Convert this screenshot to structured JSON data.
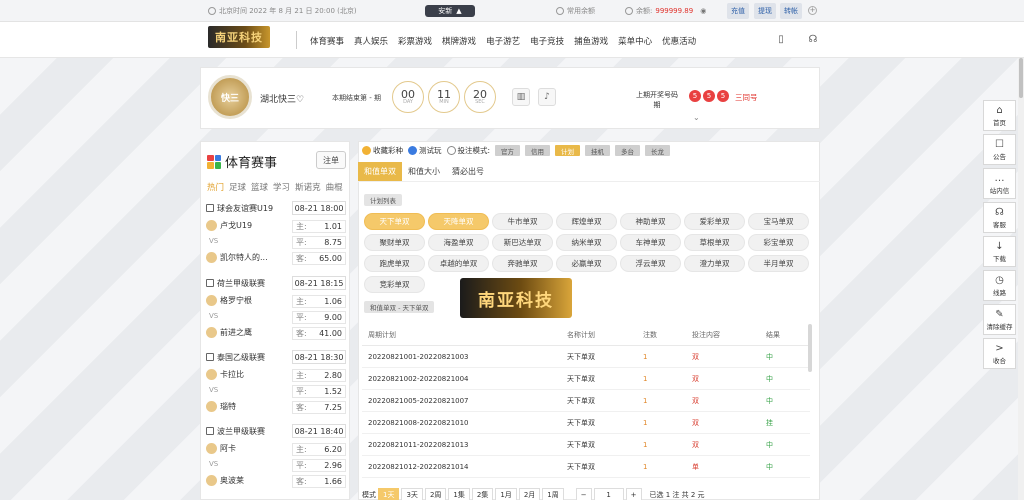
{
  "topbar": {
    "datetime": "北京时间 2022 年 8 月 21 日 20:00 (北京)",
    "safe_btn": "安新",
    "common_amount": "常用余额",
    "balance_label": "余额:",
    "balance_value": "999999.89",
    "btn_recharge": "充值",
    "btn_withdraw": "提现",
    "btn_transfer": "转帐"
  },
  "nav": {
    "logo": "南亚科技",
    "items": [
      "体育赛事",
      "真人娱乐",
      "彩票游戏",
      "棋牌游戏",
      "电子游艺",
      "电子竞技",
      "捕鱼游戏",
      "菜单中心",
      "优惠活动"
    ]
  },
  "lottery": {
    "logo_text": "快三",
    "name": "湖北快三",
    "deadline_label": "本期结束第 - 期",
    "time": [
      {
        "value": "00",
        "unit": "DAY"
      },
      {
        "value": "11",
        "unit": "MIN"
      },
      {
        "value": "20",
        "unit": "SEC"
      }
    ],
    "last_label": "上期开奖号码",
    "last_label2": "期",
    "balls": [
      "5",
      "5",
      "5"
    ],
    "result_type": "三同号"
  },
  "sports": {
    "title": "体育赛事",
    "bet_btn": "注单",
    "tabs": [
      "热门",
      "足球",
      "篮球",
      "学习",
      "斯诺克",
      "曲棍"
    ],
    "matches": [
      {
        "league": "球会友谊赛U19",
        "date": "08-21 18:00",
        "home": "卢戈U19",
        "away": "凯尔特人的...",
        "odds": [
          {
            "k": "主:",
            "v": "1.01"
          },
          {
            "k": "平:",
            "v": "8.75"
          },
          {
            "k": "客:",
            "v": "65.00"
          }
        ]
      },
      {
        "league": "荷兰甲级联赛",
        "date": "08-21 18:15",
        "home": "格罗宁根",
        "away": "前进之鹰",
        "odds": [
          {
            "k": "主:",
            "v": "1.06"
          },
          {
            "k": "平:",
            "v": "9.00"
          },
          {
            "k": "客:",
            "v": "41.00"
          }
        ]
      },
      {
        "league": "泰国乙级联赛",
        "date": "08-21 18:30",
        "home": "卡拉比",
        "away": "瑙特",
        "odds": [
          {
            "k": "主:",
            "v": "2.80"
          },
          {
            "k": "平:",
            "v": "1.52"
          },
          {
            "k": "客:",
            "v": "7.25"
          }
        ]
      },
      {
        "league": "波兰甲级联赛",
        "date": "08-21 18:40",
        "home": "阿卡",
        "away": "奥波莱",
        "odds": [
          {
            "k": "主:",
            "v": "6.20"
          },
          {
            "k": "平:",
            "v": "2.96"
          },
          {
            "k": "客:",
            "v": "1.66"
          }
        ]
      }
    ],
    "vs": "VS"
  },
  "options": {
    "fav": "收藏彩种",
    "trial": "测试玩",
    "bet_mode_label": "投注模式:",
    "modes": [
      "官方",
      "信用",
      "计划",
      "挂机",
      "多台",
      "长龙"
    ]
  },
  "subtabs": [
    "和值单双",
    "和值大小",
    "猜必出号"
  ],
  "plan_list_label": "计划列表",
  "plans": [
    "天下单双",
    "天降单双",
    "牛市单双",
    "辉煌单双",
    "神助单双",
    "爱彩单双",
    "宝马单双",
    "聚财单双",
    "海盈单双",
    "斯巴达单双",
    "纳米单双",
    "车神单双",
    "草根单双",
    "彩宝单双",
    "跑虎单双",
    "卓越的单双",
    "奔驰单双",
    "必赢单双",
    "浮云单双",
    "澄力单双",
    "半月单双",
    "竞彩单双"
  ],
  "current_label": "和值单双 - 天下单双",
  "watermark": "南亚科技",
  "table": {
    "headers": [
      "周期计划",
      "名称计划",
      "注数",
      "投注内容",
      "结果"
    ],
    "rows": [
      {
        "period": "20220821001-20220821003",
        "name": "天下单双",
        "count": "1",
        "content": "双",
        "result": "中"
      },
      {
        "period": "20220821002-20220821004",
        "name": "天下单双",
        "count": "1",
        "content": "双",
        "result": "中"
      },
      {
        "period": "20220821005-20220821007",
        "name": "天下单双",
        "count": "1",
        "content": "双",
        "result": "中"
      },
      {
        "period": "20220821008-20220821010",
        "name": "天下单双",
        "count": "1",
        "content": "双",
        "result": "挂"
      },
      {
        "period": "20220821011-20220821013",
        "name": "天下单双",
        "count": "1",
        "content": "双",
        "result": "中"
      },
      {
        "period": "20220821012-20220821014",
        "name": "天下单双",
        "count": "1",
        "content": "单",
        "result": "中"
      }
    ]
  },
  "pager": {
    "mode_label": "模式",
    "periods": [
      "1天",
      "3天",
      "2周",
      "1集",
      "2集",
      "1月",
      "2月",
      "1周"
    ],
    "minus": "−",
    "page": "1",
    "plus": "+",
    "total": "已选 1 注 共 2 元"
  },
  "rightbar": [
    {
      "icon": "⌂",
      "label": "首页"
    },
    {
      "icon": "☐",
      "label": "公告"
    },
    {
      "icon": "…",
      "label": "站内信"
    },
    {
      "icon": "☊",
      "label": "客服"
    },
    {
      "icon": "↓",
      "label": "下载"
    },
    {
      "icon": "◷",
      "label": "线路"
    },
    {
      "icon": "✎",
      "label": "清除缓存"
    },
    {
      "icon": ">",
      "label": "收合"
    }
  ]
}
